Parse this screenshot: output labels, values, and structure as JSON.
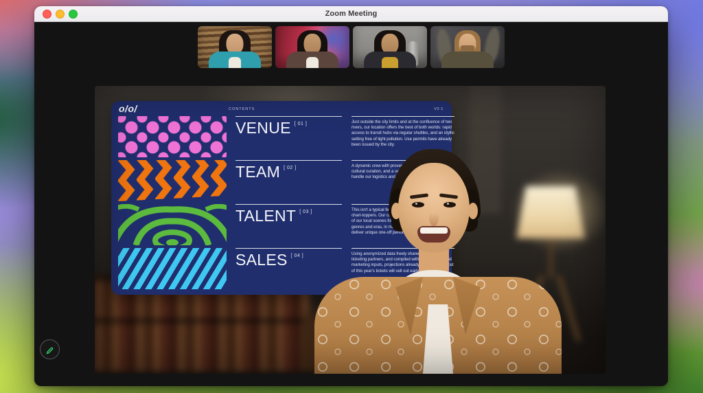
{
  "window": {
    "title": "Zoom Meeting"
  },
  "filmstrip": {
    "participants": [
      {
        "id": "participant-video-1",
        "description": "woman with dark hair in teal jacket, wood-panel wall"
      },
      {
        "id": "participant-video-2",
        "description": "woman with dark hair in brown blazer, colorful abstract backdrop"
      },
      {
        "id": "participant-video-3",
        "description": "woman with dark hair in mustard top, concrete wall with vase"
      },
      {
        "id": "participant-video-4",
        "description": "man with light brown hair and beard, dark wall with dried leaves"
      }
    ]
  },
  "main_video": {
    "presenter_description": "man in tan embroidered jacket presenting beside shared slide"
  },
  "slide": {
    "logo": "o/o/",
    "contents_label": "CONTENTS",
    "version": "V2:1",
    "sections": [
      {
        "title": "VENUE",
        "number": "[ 01 ]",
        "pattern": "pink-dots",
        "description": "Just outside the city limits and at the confluence of two rivers, our location offers the best of both worlds: rapid access to transit hubs via regular shuttles, and an idyllic setting free of light pollution. Use permits have already been issued by the city."
      },
      {
        "title": "TEAM",
        "number": "[ 02 ]",
        "pattern": "orange-chevrons",
        "description": "A dynamic crew with proven credits in live production, cultural curation, and a set of specialized partners to handle our logistics and health and safety."
      },
      {
        "title": "TALENT",
        "number": "[ 03 ]",
        "pattern": "green-contours",
        "description": "This isn't a typical festival lineup of the who's who of chart-toppers. Our curators instead explore the fringes of our local scenes for a mix of performers spanning genres and eras, in many cases, encouraging acts to deliver unique one-off performances."
      },
      {
        "title": "SALES",
        "number": "[ 04 ]",
        "pattern": "cyan-stripes",
        "description": "Using anonymized data freely shared with us by our ticketing partners, and compiled without any additional marketing inputs, projections already suggest that most of this year's tickets will sell out early."
      }
    ],
    "colors": {
      "slide_navy": "#202e6d",
      "dots_pink": "#ef72d5",
      "chevron_orange": "#f0750f",
      "contour_green": "#5cba3f",
      "stripe_cyan": "#3fc9f2"
    }
  },
  "controls": {
    "annotate_icon": "pencil",
    "annotate_color": "#35d46a"
  }
}
